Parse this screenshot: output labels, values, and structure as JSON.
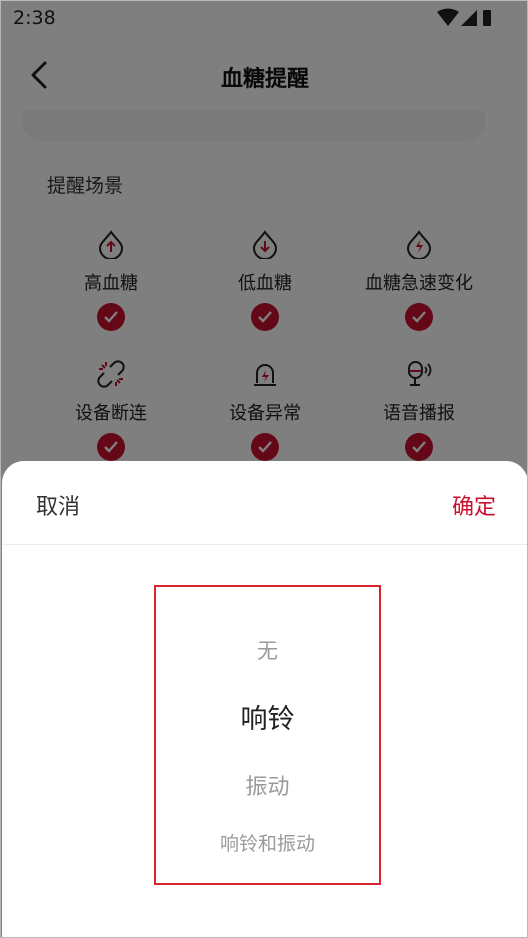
{
  "status_bar": {
    "time": "2:38"
  },
  "header": {
    "title": "血糖提醒"
  },
  "section": {
    "title": "提醒场景"
  },
  "scenes": [
    {
      "label": "高血糖",
      "icon": "drop-up-icon"
    },
    {
      "label": "低血糖",
      "icon": "drop-down-icon"
    },
    {
      "label": "血糖急速变化",
      "icon": "drop-lightning-icon"
    },
    {
      "label": "设备断连",
      "icon": "broken-link-icon"
    },
    {
      "label": "设备异常",
      "icon": "alarm-light-icon"
    },
    {
      "label": "语音播报",
      "icon": "microphone-sound-icon"
    }
  ],
  "sheet": {
    "cancel": "取消",
    "confirm": "确定",
    "options": [
      "无",
      "响铃",
      "振动",
      "响铃和振动"
    ],
    "selected": "响铃"
  },
  "colors": {
    "accent": "#c8102e",
    "highlight_border": "#d9232e"
  }
}
